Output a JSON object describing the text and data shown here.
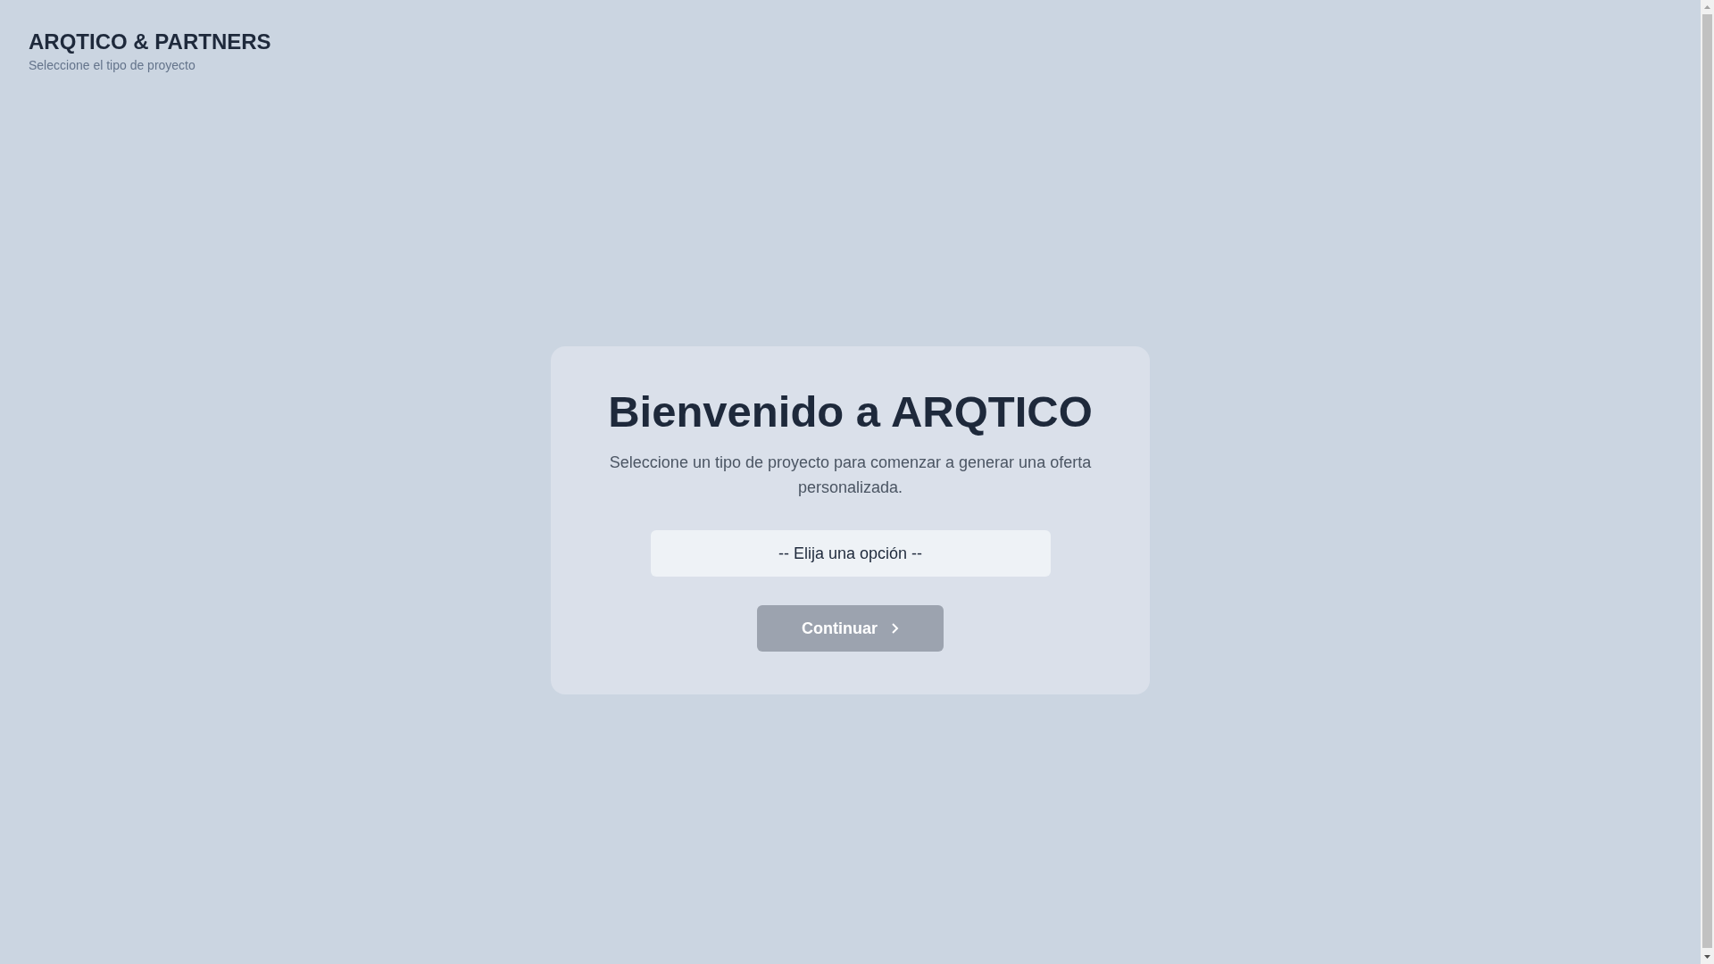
{
  "header": {
    "title": "ARQTICO & PARTNERS",
    "subtitle": "Seleccione el tipo de proyecto"
  },
  "card": {
    "title": "Bienvenido a ARQTICO",
    "description": "Seleccione un tipo de proyecto para comenzar a generar una oferta personalizada.",
    "project_select": {
      "value": "-- Elija una opción --"
    },
    "continue_button": {
      "label": "Continuar",
      "disabled": true
    }
  }
}
